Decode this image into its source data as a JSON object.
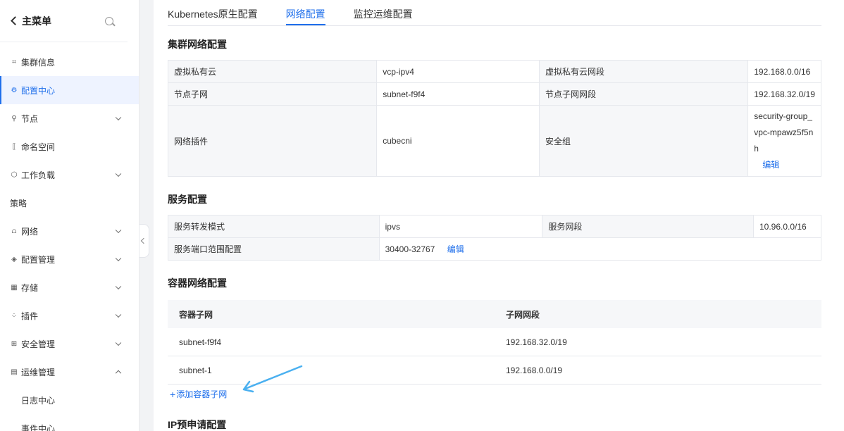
{
  "sidebar": {
    "back_label": "主菜单",
    "items": [
      {
        "label": "集群信息",
        "icon": "cluster-icon",
        "glyph": "⌗"
      },
      {
        "label": "配置中心",
        "icon": "settings-icon",
        "glyph": "⚙"
      },
      {
        "label": "节点",
        "icon": "node-icon",
        "glyph": "⚲"
      },
      {
        "label": "命名空间",
        "icon": "namespace-icon",
        "glyph": "⟦"
      },
      {
        "label": "工作负载",
        "icon": "workload-icon",
        "glyph": "⬡"
      },
      {
        "label": "策略"
      },
      {
        "label": "网络",
        "icon": "network-icon",
        "glyph": "⩍"
      },
      {
        "label": "配置管理",
        "icon": "config-icon",
        "glyph": "◈"
      },
      {
        "label": "存储",
        "icon": "storage-icon",
        "glyph": "▦"
      },
      {
        "label": "插件",
        "icon": "plugin-icon",
        "glyph": "⁘"
      },
      {
        "label": "安全管理",
        "icon": "security-icon",
        "glyph": "⊞"
      },
      {
        "label": "运维管理",
        "icon": "ops-icon",
        "glyph": "▤"
      },
      {
        "label": "日志中心"
      },
      {
        "label": "事件中心"
      }
    ]
  },
  "tabs": [
    "Kubernetes原生配置",
    "网络配置",
    "监控运维配置"
  ],
  "cluster_network": {
    "title": "集群网络配置",
    "vpc_label": "虚拟私有云",
    "vpc_value": "vcp-ipv4",
    "vpc_cidr_label": "虚拟私有云网段",
    "vpc_cidr_value": "192.168.0.0/16",
    "subnet_label": "节点子网",
    "subnet_value": "subnet-f9f4",
    "subnet_cidr_label": "节点子网网段",
    "subnet_cidr_value": "192.168.32.0/19",
    "plugin_label": "网络插件",
    "plugin_value": "cubecni",
    "sg_label": "安全组",
    "sg_value": "security-group_vpc-mpawz5f5nh",
    "sg_edit": "编辑"
  },
  "service": {
    "title": "服务配置",
    "mode_label": "服务转发模式",
    "mode_value": "ipvs",
    "cidr_label": "服务网段",
    "cidr_value": "10.96.0.0/16",
    "port_label": "服务端口范围配置",
    "port_value": "30400-32767",
    "port_edit": "编辑"
  },
  "container_network": {
    "title": "容器网络配置",
    "col1": "容器子网",
    "col2": "子网网段",
    "rows": [
      {
        "subnet": "subnet-f9f4",
        "cidr": "192.168.32.0/19"
      },
      {
        "subnet": "subnet-1",
        "cidr": "192.168.0.0/19"
      }
    ],
    "add_plus": "+",
    "add_label": "添加容器子网"
  },
  "ip_prealloc": {
    "title": "IP预申请配置"
  },
  "colors": {
    "accent": "#1f6feb",
    "annotation_arrow": "#4ab0f0"
  }
}
